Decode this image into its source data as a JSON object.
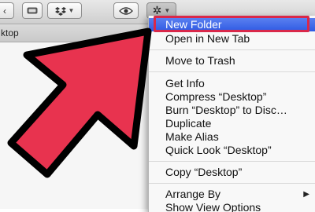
{
  "toolbar": {
    "buttons": [
      {
        "name": "view-toggle-icon"
      },
      {
        "name": "dropbox-icon"
      },
      {
        "name": "quick-look-eye-icon"
      },
      {
        "name": "gear-icon"
      }
    ]
  },
  "pathbar": {
    "label": "ktop"
  },
  "menu": {
    "items": [
      {
        "label": "New Folder",
        "selected": true
      },
      {
        "label": "Open in New Tab"
      },
      {
        "label": "Move to Trash"
      },
      {
        "label": "Get Info"
      },
      {
        "label": "Compress “Desktop”"
      },
      {
        "label": "Burn “Desktop” to Disc…"
      },
      {
        "label": "Duplicate"
      },
      {
        "label": "Make Alias"
      },
      {
        "label": "Quick Look “Desktop”"
      },
      {
        "label": "Copy “Desktop”"
      },
      {
        "label": "Arrange By",
        "submenu_arrow": "▶"
      },
      {
        "label": "Show View Options"
      }
    ]
  },
  "colors": {
    "selection": "#2f5be3",
    "annotation_red": "#e8334f",
    "highlight_border": "#d9284a"
  }
}
